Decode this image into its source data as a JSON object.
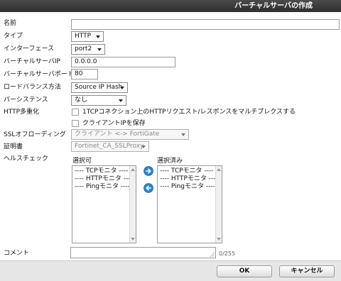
{
  "dialog": {
    "title": "バーチャルサーバの作成"
  },
  "form": {
    "name_label": "名前",
    "name_value": "",
    "type_label": "タイプ",
    "type_value": "HTTP",
    "interface_label": "インターフェース",
    "interface_value": "port2",
    "vip_label": "バーチャルサーバIP",
    "vip_value": "0.0.0.0",
    "vport_label": "バーチャルサーバポート",
    "vport_value": "80",
    "lb_label": "ロードバランス方法",
    "lb_value": "Source IP Hash",
    "persistence_label": "パーシステンス",
    "persistence_value": "なし",
    "http_mux_label": "HTTP多重化",
    "http_mux_option": "1TCPコネクション上のHTTPリクエスト/レスポンスをマルチプレクスする",
    "http_mux_checked": false,
    "preserve_ip_option": "クライアントIPを保存",
    "preserve_ip_checked": false,
    "ssl_offload_label": "SSLオフローディング",
    "ssl_offload_value": "クライアント <-> FortiGate",
    "cert_label": "証明書",
    "cert_value": "Fortinet_CA_SSLProxy",
    "health_label": "ヘルスチェック",
    "available_label": "選択可",
    "selected_label": "選択済み",
    "available_items": [
      "---- TCPモニタ ----",
      "---- HTTPモニタ ----",
      "---- Pingモニタ ----"
    ],
    "selected_items": [
      "---- TCPモニタ ----",
      "---- HTTPモニタ ----",
      "---- Pingモニタ ----"
    ],
    "comment_label": "コメント",
    "comment_value": "",
    "comment_counter": "0/255"
  },
  "buttons": {
    "ok": "OK",
    "cancel": "キャンセル"
  },
  "icons": {
    "add": "arrow-right-icon",
    "remove": "arrow-left-icon"
  },
  "colors": {
    "titlebar": "#3a3a3a",
    "move_button": "#2a86d0"
  }
}
